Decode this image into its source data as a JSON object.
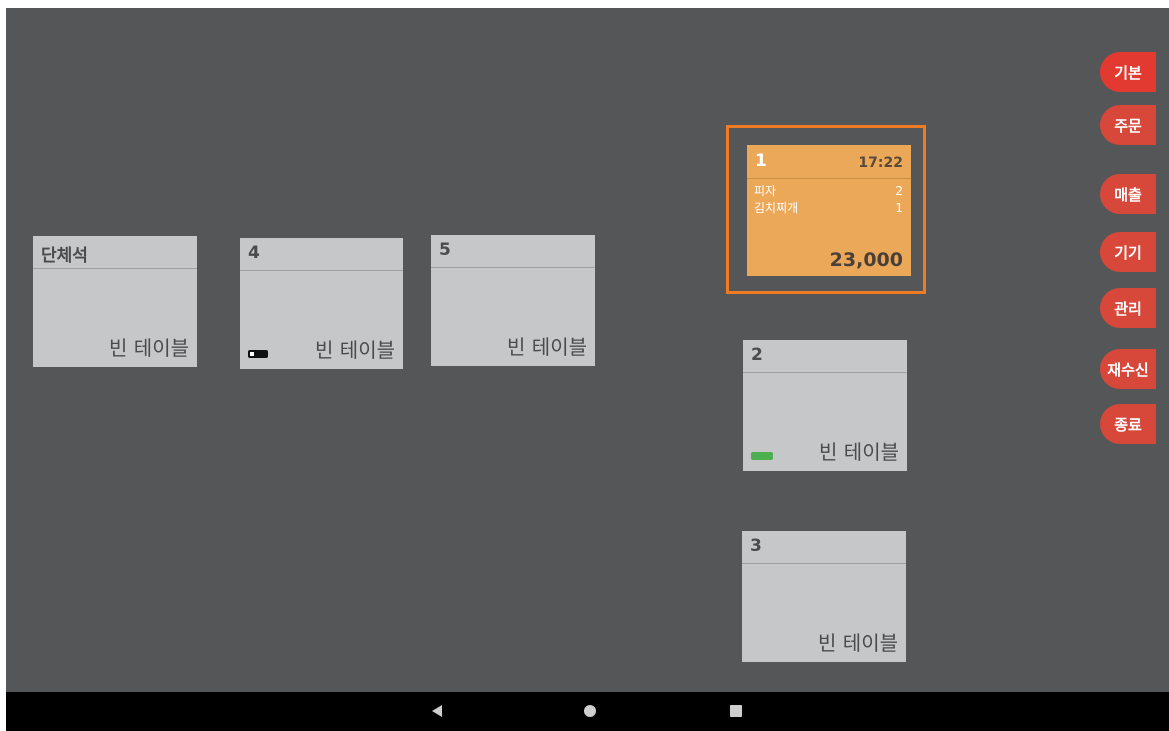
{
  "tables": {
    "group": {
      "name": "단체석",
      "status": "빈 테이블"
    },
    "t4": {
      "name": "4",
      "status": "빈 테이블",
      "battery": "low"
    },
    "t5": {
      "name": "5",
      "status": "빈 테이블"
    },
    "t1": {
      "name": "1",
      "time": "17:22",
      "orders": [
        {
          "item": "피자",
          "qty": "2"
        },
        {
          "item": "김치찌개",
          "qty": "1"
        }
      ],
      "total": "23,000"
    },
    "t2": {
      "name": "2",
      "status": "빈 테이블",
      "battery": "full"
    },
    "t3": {
      "name": "3",
      "status": "빈 테이블"
    }
  },
  "side_menu": {
    "items": [
      {
        "label": "기본",
        "active": true
      },
      {
        "label": "주문"
      },
      {
        "label": "매출"
      },
      {
        "label": "기기"
      },
      {
        "label": "관리"
      },
      {
        "label": "재수신"
      },
      {
        "label": "종료"
      }
    ]
  },
  "colors": {
    "background": "#555658",
    "empty_table": "#c6c7c9",
    "occupied_table": "#eba858",
    "selected_border": "#ef7c22",
    "menu_button": "#d8483a",
    "menu_button_active": "#e23a31",
    "battery_full": "#4caf50"
  },
  "icons": {
    "nav_back": "triangle-back-icon",
    "nav_home": "circle-home-icon",
    "nav_recent": "square-recents-icon",
    "battery_low": "battery-low-icon",
    "battery_full": "battery-full-icon"
  }
}
